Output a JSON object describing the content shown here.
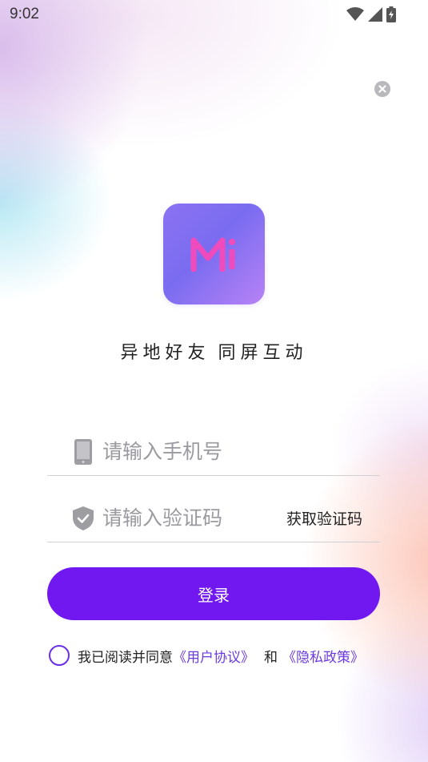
{
  "status_bar": {
    "time": "9:02",
    "icons": [
      "wifi-icon",
      "cellular-signal-icon",
      "battery-charging-icon"
    ]
  },
  "close_button": {
    "icon": "close-icon"
  },
  "logo": {
    "text": "Mi",
    "colors": {
      "bg_start": "#8b72f2",
      "bg_end": "#b882f5",
      "letter": "#f04bbd"
    }
  },
  "slogan": {
    "part1": "异地好友",
    "part2": "同屏互动"
  },
  "phone_field": {
    "placeholder": "请输入手机号",
    "value": "",
    "icon": "phone-icon"
  },
  "code_field": {
    "placeholder": "请输入验证码",
    "value": "",
    "icon": "shield-icon",
    "get_code_label": "获取验证码"
  },
  "login_button": {
    "label": "登录",
    "color": "#7117f0"
  },
  "agreement": {
    "prefix": "我已阅读并同意",
    "user_agreement": "《用户协议》",
    "and": "和",
    "privacy_policy": "《隐私政策》",
    "link_color": "#6a3be0"
  }
}
